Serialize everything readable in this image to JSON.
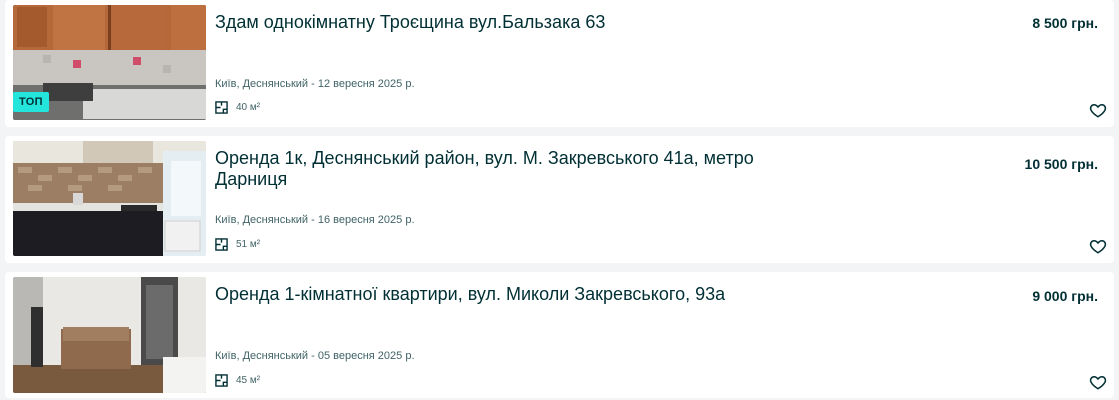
{
  "listings": [
    {
      "title": "Здам однокімнатну Троєщина вул.Бальзака 63",
      "price": "8 500 грн.",
      "location_date": "Київ, Деснянський - 12 вересня 2025 р.",
      "area": "40 м²",
      "badge": "ТОП",
      "area_icon": "floor-plan-icon",
      "favorite_icon": "heart-outline-icon"
    },
    {
      "title": "Оренда 1к, Деснянський район, вул. М. Закревського 41а, метро Дарниця",
      "price": "10 500 грн.",
      "location_date": "Київ, Деснянський - 16 вересня 2025 р.",
      "area": "51 м²",
      "area_icon": "floor-plan-icon",
      "favorite_icon": "heart-outline-icon"
    },
    {
      "title": "Оренда 1-кімнатної квартири, вул. Миколи Закревського, 93а",
      "price": "9 000 грн.",
      "location_date": "Київ, Деснянський - 05 вересня 2025 р.",
      "area": "45 м²",
      "area_icon": "floor-plan-icon",
      "favorite_icon": "heart-outline-icon"
    }
  ],
  "colors": {
    "text_primary": "#002f34",
    "text_secondary": "#406367",
    "badge_bg": "#23e5db",
    "page_bg": "#f2f4f5"
  }
}
